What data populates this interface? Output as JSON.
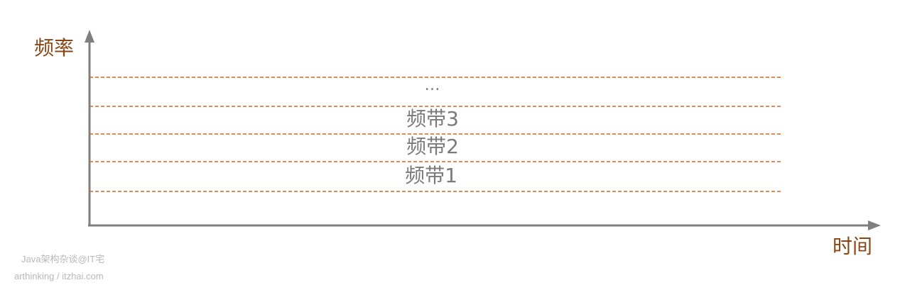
{
  "axes": {
    "y_label": "频率",
    "x_label": "时间"
  },
  "bands": [
    {
      "label": "频带1"
    },
    {
      "label": "频带2"
    },
    {
      "label": "频带3"
    },
    {
      "label": "…"
    }
  ],
  "watermark": {
    "line1": "Java架构杂谈@IT宅",
    "line2": "arthinking / itzhai.com"
  },
  "colors": {
    "axis": "#7f7f7f",
    "band_line": "#d2691e",
    "axis_label": "#8B4513",
    "band_label": "#7a7a7a",
    "watermark": "#b8b8b8"
  }
}
